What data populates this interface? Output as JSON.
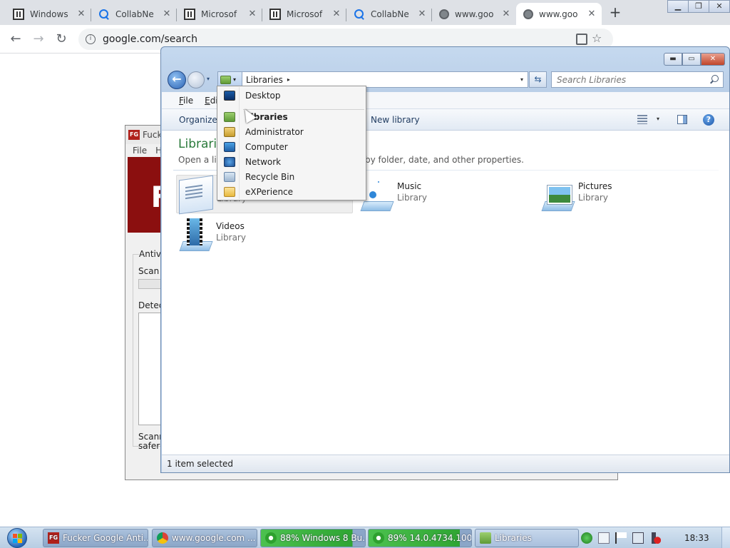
{
  "browser": {
    "tabs": [
      {
        "title": "Windows",
        "icon": "page-icon"
      },
      {
        "title": "CollabNe",
        "icon": "search-icon"
      },
      {
        "title": "Microsof",
        "icon": "page-icon"
      },
      {
        "title": "Microsof",
        "icon": "page-icon"
      },
      {
        "title": "CollabNe",
        "icon": "search-icon"
      },
      {
        "title": "www.goo",
        "icon": "globe-icon"
      },
      {
        "title": "www.goo",
        "icon": "globe-icon"
      }
    ],
    "tab_close_glyph": "✕",
    "new_tab_glyph": "+",
    "window_buttons": {
      "minimize": "▁",
      "maximize": "❐",
      "close": "✕"
    },
    "nav": {
      "back": "←",
      "forward": "→",
      "reload": "↻"
    },
    "info_glyph": "i",
    "url": "google.com/search"
  },
  "antivirus": {
    "title": "Fucker",
    "badge": "FG",
    "menu": [
      "File",
      "H"
    ],
    "banner_letter": "F",
    "group_label": "Antivi",
    "scan_label": "Scan",
    "detect_label": "Detec",
    "status_line1": "Scanni",
    "status_line2": "safer f"
  },
  "explorer": {
    "caption": {
      "minimize": "▬",
      "maximize": "▭",
      "close": "✕"
    },
    "back_glyph": "←",
    "history_glyph": "▾",
    "address": {
      "location": "Libraries",
      "arrow": "▸",
      "dropdown": "▾"
    },
    "refresh_glyph": "⇆",
    "search_placeholder": "Search Libraries",
    "menubar": [
      "File",
      "Edit"
    ],
    "commands": {
      "organize": "Organize",
      "organize_arrow": "▾",
      "new_library": "New library",
      "view_arrow": "▾",
      "help": "?"
    },
    "content": {
      "title": "Librari",
      "subtitle": "Open a libr",
      "subtitle_tail": "by folder, date, and other properties."
    },
    "libraries": [
      {
        "name": "",
        "kind": "Library",
        "icon": "documents-library-icon",
        "selected": true
      },
      {
        "name": "Music",
        "kind": "Library",
        "icon": "music-library-icon",
        "selected": false
      },
      {
        "name": "Pictures",
        "kind": "Library",
        "icon": "pictures-library-icon",
        "selected": false
      },
      {
        "name": "Videos",
        "kind": "Library",
        "icon": "videos-library-icon",
        "selected": false
      }
    ],
    "status": "1 item selected",
    "dropdown": [
      {
        "label": "Desktop",
        "icon": "desktop-icon",
        "bold": false
      },
      {
        "label": "Libraries",
        "icon": "libraries-icon",
        "bold": true
      },
      {
        "label": "Administrator",
        "icon": "user-folder-icon",
        "bold": false
      },
      {
        "label": "Computer",
        "icon": "computer-icon",
        "bold": false
      },
      {
        "label": "Network",
        "icon": "network-icon",
        "bold": false
      },
      {
        "label": "Recycle Bin",
        "icon": "recycle-bin-icon",
        "bold": false
      },
      {
        "label": "eXPerience",
        "icon": "folder-icon",
        "bold": false
      }
    ]
  },
  "taskbar": {
    "tasks": [
      {
        "label": "Fucker Google Anti...",
        "icon": "fg-app-icon"
      },
      {
        "label": "www.google.com ...",
        "icon": "chrome-icon"
      },
      {
        "label": "88% Windows 8 Bu...",
        "icon": "download-icon",
        "progress": 88
      },
      {
        "label": "89% 14.0.4734.1000...",
        "icon": "download-icon",
        "progress": 89
      },
      {
        "label": "Libraries",
        "icon": "libraries-icon"
      }
    ],
    "clock": "18:33"
  }
}
